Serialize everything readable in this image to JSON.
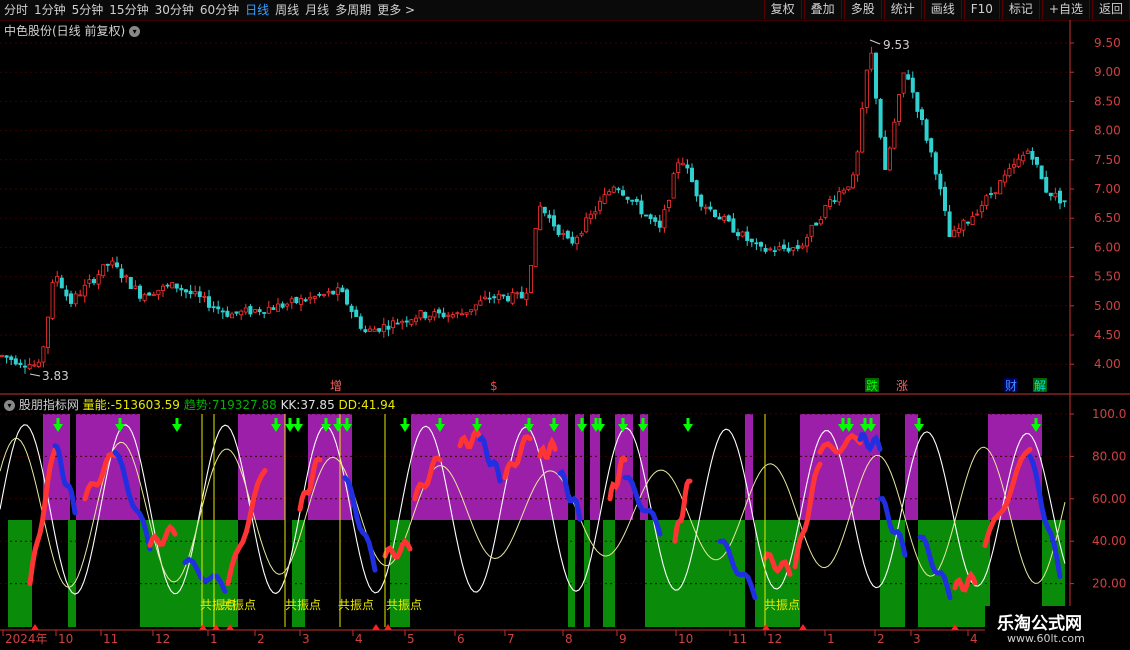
{
  "toolbar": {
    "periods": [
      "分时",
      "1分钟",
      "5分钟",
      "15分钟",
      "30分钟",
      "60分钟",
      "日线",
      "周线",
      "月线",
      "多周期",
      "更多 >"
    ],
    "active_period": "日线",
    "actions": [
      "复权",
      "叠加",
      "多股",
      "统计",
      "画线",
      "F10",
      "标记",
      "+自选",
      "返回"
    ]
  },
  "title": "中色股份(日线 前复权)",
  "price_axis": [
    "9.50",
    "9.00",
    "8.50",
    "8.00",
    "7.50",
    "7.00",
    "6.50",
    "6.00",
    "5.50",
    "5.00",
    "4.50",
    "4.00"
  ],
  "high_label": "9.53",
  "low_label": "3.83",
  "event_markers": [
    {
      "text": "增",
      "color": "#ff6060"
    },
    {
      "text": "$",
      "color": "#ff4040"
    },
    {
      "text": "跌",
      "color": "#00ff00"
    },
    {
      "text": "涨",
      "color": "#ff6060"
    },
    {
      "text": "财",
      "color": "#4090ff"
    },
    {
      "text": "解",
      "color": "#00e0e0"
    }
  ],
  "indicator": {
    "name": "股朋指标网",
    "liangneng_label": "量能:",
    "liangneng_value": "-513603.59",
    "qushi_label": "趋势:",
    "qushi_value": "719327.88",
    "kk_label": "KK:",
    "kk_value": "37.85",
    "dd_label": "DD:",
    "dd_value": "41.94",
    "axis": [
      "100.0",
      "80.00",
      "60.00",
      "40.00",
      "20.00"
    ],
    "resonance_labels": [
      "共振点",
      "共振点",
      "共振点",
      "共振点",
      "共振点",
      "共振点"
    ]
  },
  "date_axis": [
    "2024年",
    "10",
    "11",
    "12",
    "1",
    "2",
    "3",
    "4",
    "5",
    "6",
    "7",
    "8",
    "9",
    "10",
    "11",
    "12",
    "1",
    "2",
    "3",
    "4"
  ],
  "watermark": {
    "line1": "乐淘公式网",
    "line2": "www.60lt.com"
  },
  "colors": {
    "up": "#ff3030",
    "down": "#30d0d0",
    "purple": "#9b1fa8",
    "green": "#0a8c0a",
    "axis": "#c83030"
  }
}
